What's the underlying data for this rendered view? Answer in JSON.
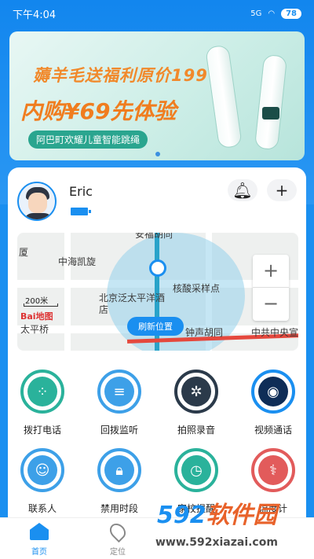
{
  "status": {
    "time": "下午4:04",
    "signal": "5G",
    "battery": "78"
  },
  "banner": {
    "line1": "薅羊毛送福利原价199",
    "line2": "内购¥69先体验",
    "pill": "阿巴町欢耀儿童智能跳绳"
  },
  "device": {
    "name": "Eric",
    "battery_level": 1.0
  },
  "map": {
    "labels": {
      "xia": "厦",
      "zhonghai": "中海凯旋",
      "yongfeng": "安福胡同",
      "hesuan": "核酸采样点",
      "beijing": "北京泛太平洋酒店",
      "taiping": "太平桥",
      "zhongsheng": "钟声胡同",
      "zhonggong": "中共中央宣",
      "scale": "200米",
      "baidu": "Bai地图"
    },
    "refresh_label": "刷新位置",
    "zoom_in": "+",
    "zoom_out": "−"
  },
  "functions": [
    {
      "label": "拨打电话",
      "icon": "phone-dialpad-icon"
    },
    {
      "label": "回拨监听",
      "icon": "listen-icon"
    },
    {
      "label": "拍照录音",
      "icon": "camera-record-icon"
    },
    {
      "label": "视频通话",
      "icon": "video-call-icon"
    },
    {
      "label": "联系人",
      "icon": "contacts-icon"
    },
    {
      "label": "禁用时段",
      "icon": "lock-icon"
    },
    {
      "label": "家校提醒",
      "icon": "clock-icon"
    },
    {
      "label": "温度计",
      "icon": "thermometer-icon"
    }
  ],
  "tabs": [
    {
      "label": "首页",
      "active": true
    },
    {
      "label": "定位",
      "active": false
    }
  ],
  "watermark": {
    "brand_num": "592",
    "brand_text": "软件园",
    "url": "www.592xiazai.com"
  },
  "colors": {
    "accent": "#1a8ff0",
    "orange": "#f07d1f",
    "teal": "#2aa58f"
  }
}
